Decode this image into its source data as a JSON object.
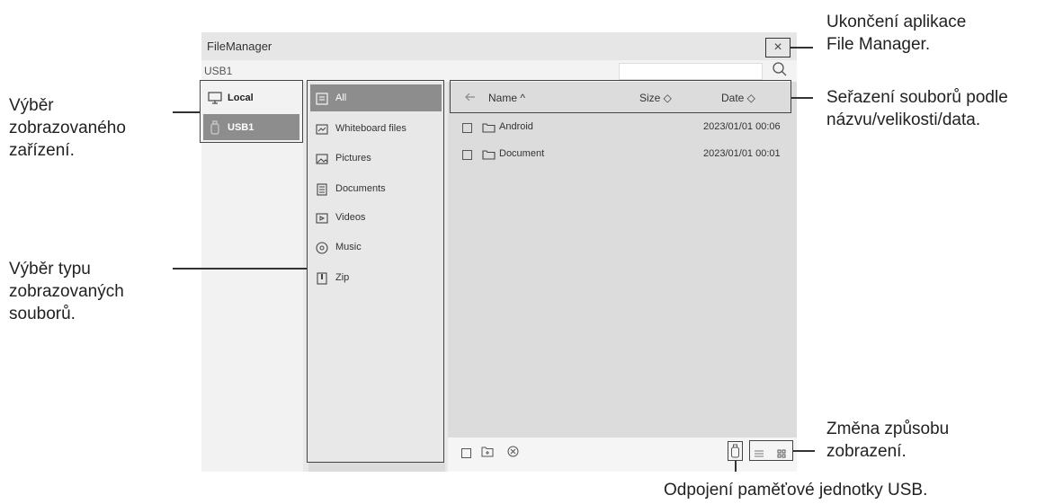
{
  "app": {
    "title": "FileManager",
    "close_glyph": "×",
    "path": "USB1"
  },
  "search": {
    "placeholder": "",
    "icon": "search-icon"
  },
  "devices": [
    {
      "label": "Local",
      "icon": "monitor-icon",
      "selected": false
    },
    {
      "label": "USB1",
      "icon": "usb-drive-icon",
      "selected": true
    }
  ],
  "file_types": [
    {
      "label": "All",
      "icon": "all-files-icon",
      "selected": true
    },
    {
      "label": "Whiteboard files",
      "icon": "whiteboard-icon",
      "selected": false
    },
    {
      "label": "Pictures",
      "icon": "picture-icon",
      "selected": false
    },
    {
      "label": "Documents",
      "icon": "document-icon",
      "selected": false
    },
    {
      "label": "Videos",
      "icon": "video-icon",
      "selected": false
    },
    {
      "label": "Music",
      "icon": "music-icon",
      "selected": false
    },
    {
      "label": "Zip",
      "icon": "zip-icon",
      "selected": false
    }
  ],
  "list_header": {
    "name": "Name ^",
    "size": "Size ◇",
    "date": "Date ◇"
  },
  "files": [
    {
      "name": "Android",
      "date": "2023/01/01 00:06"
    },
    {
      "name": "Document",
      "date": "2023/01/01 00:01"
    }
  ],
  "annotations": {
    "exit": [
      "Ukončení aplikace",
      "File Manager."
    ],
    "sort": [
      "Seřazení souborů podle",
      "názvu/velikosti/data."
    ],
    "device": [
      "Výběr",
      "zobrazovaného",
      "zařízení."
    ],
    "type": [
      "Výběr typu",
      "zobrazovaných",
      "souborů."
    ],
    "view": [
      "Změna způsobu",
      "zobrazení."
    ],
    "eject": "Odpojení paměťové jednotky USB."
  }
}
